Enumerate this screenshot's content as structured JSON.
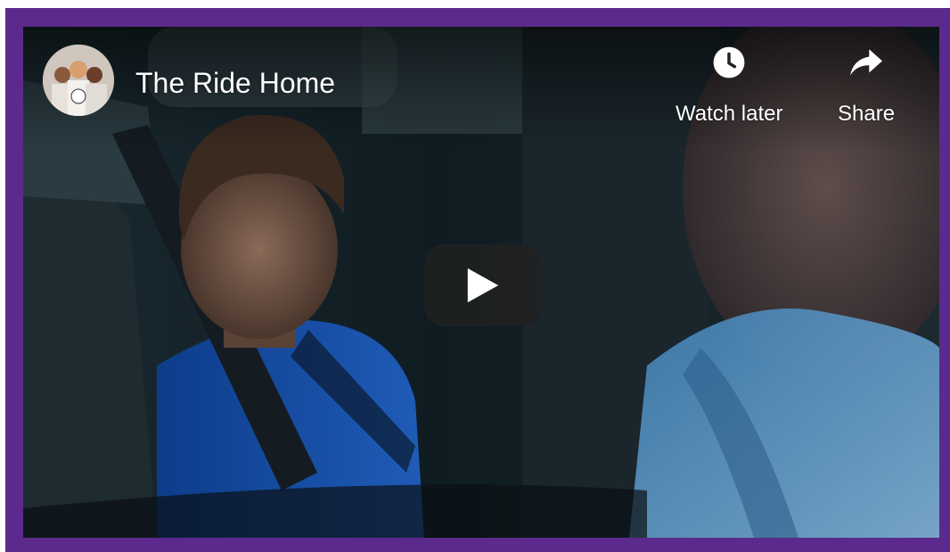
{
  "video": {
    "title": "The Ride Home",
    "channel_avatar": "channel-avatar-photo"
  },
  "actions": {
    "watch_later": {
      "label": "Watch later",
      "icon": "clock-icon"
    },
    "share": {
      "label": "Share",
      "icon": "share-arrow-icon"
    }
  },
  "player": {
    "play_icon": "play-icon"
  },
  "colors": {
    "frame_border": "#5b2a8c",
    "overlay_text": "#ffffff",
    "play_button_bg": "#212121"
  }
}
